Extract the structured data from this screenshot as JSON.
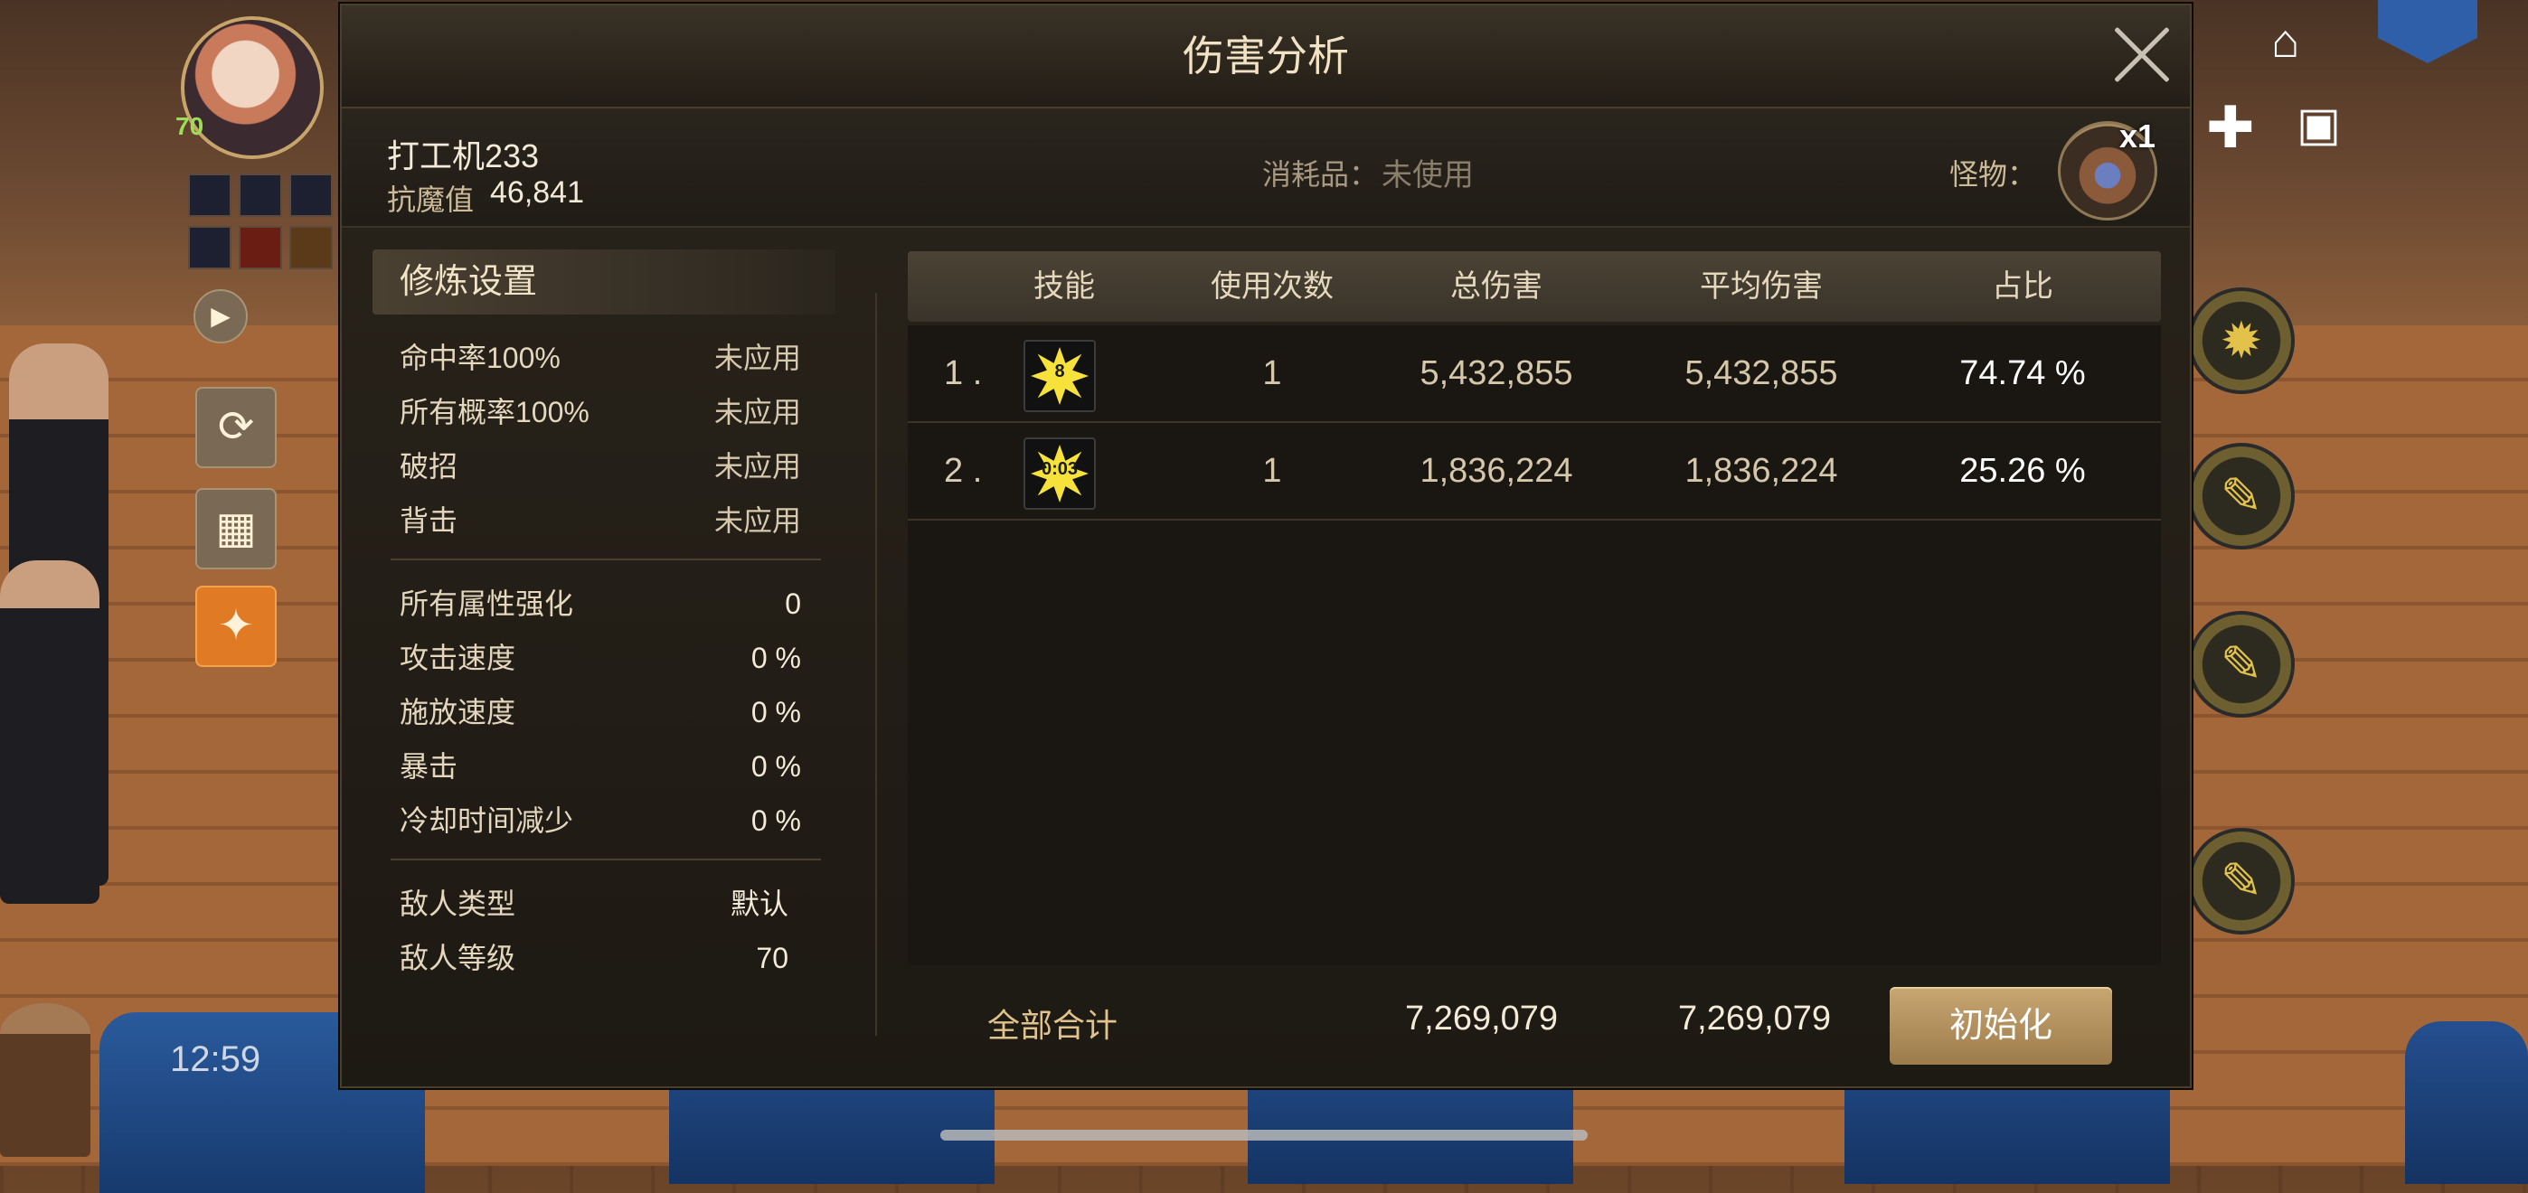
{
  "background": {
    "clock": "12:59",
    "character_level": "70"
  },
  "dialog": {
    "title": "伤害分析",
    "player_name": "打工机233",
    "resist_label": "抗魔值",
    "resist_value": "46,841",
    "consumable_label": "消耗品：",
    "consumable_value": "未使用",
    "monster_label": "怪物：",
    "monster_count": "x1",
    "training": {
      "title": "修炼设置",
      "group1": [
        {
          "label": "命中率100%",
          "value": "未应用"
        },
        {
          "label": "所有概率100%",
          "value": "未应用"
        },
        {
          "label": "破招",
          "value": "未应用"
        },
        {
          "label": "背击",
          "value": "未应用"
        }
      ],
      "group2": [
        {
          "label": "所有属性强化",
          "value": "0"
        },
        {
          "label": "攻击速度",
          "value": "0 %"
        },
        {
          "label": "施放速度",
          "value": "0 %"
        },
        {
          "label": "暴击",
          "value": "0 %"
        },
        {
          "label": "冷却时间减少",
          "value": "0 %"
        }
      ],
      "group3": [
        {
          "label": "敌人类型",
          "value": "默认"
        },
        {
          "label": "敌人等级",
          "value": "70"
        }
      ]
    },
    "table": {
      "headers": {
        "skill": "技能",
        "uses": "使用次数",
        "total": "总伤害",
        "average": "平均伤害",
        "share": "占比"
      },
      "rows": [
        {
          "rank": "1 .",
          "skill_tag": "8",
          "uses": "1",
          "total": "5,432,855",
          "average": "5,432,855",
          "share": "74.74 %"
        },
        {
          "rank": "2 .",
          "skill_tag": "0:03",
          "uses": "1",
          "total": "1,836,224",
          "average": "1,836,224",
          "share": "25.26 %"
        }
      ]
    },
    "footer": {
      "label": "全部合计",
      "total": "7,269,079",
      "average": "7,269,079",
      "reset_label": "初始化"
    }
  }
}
